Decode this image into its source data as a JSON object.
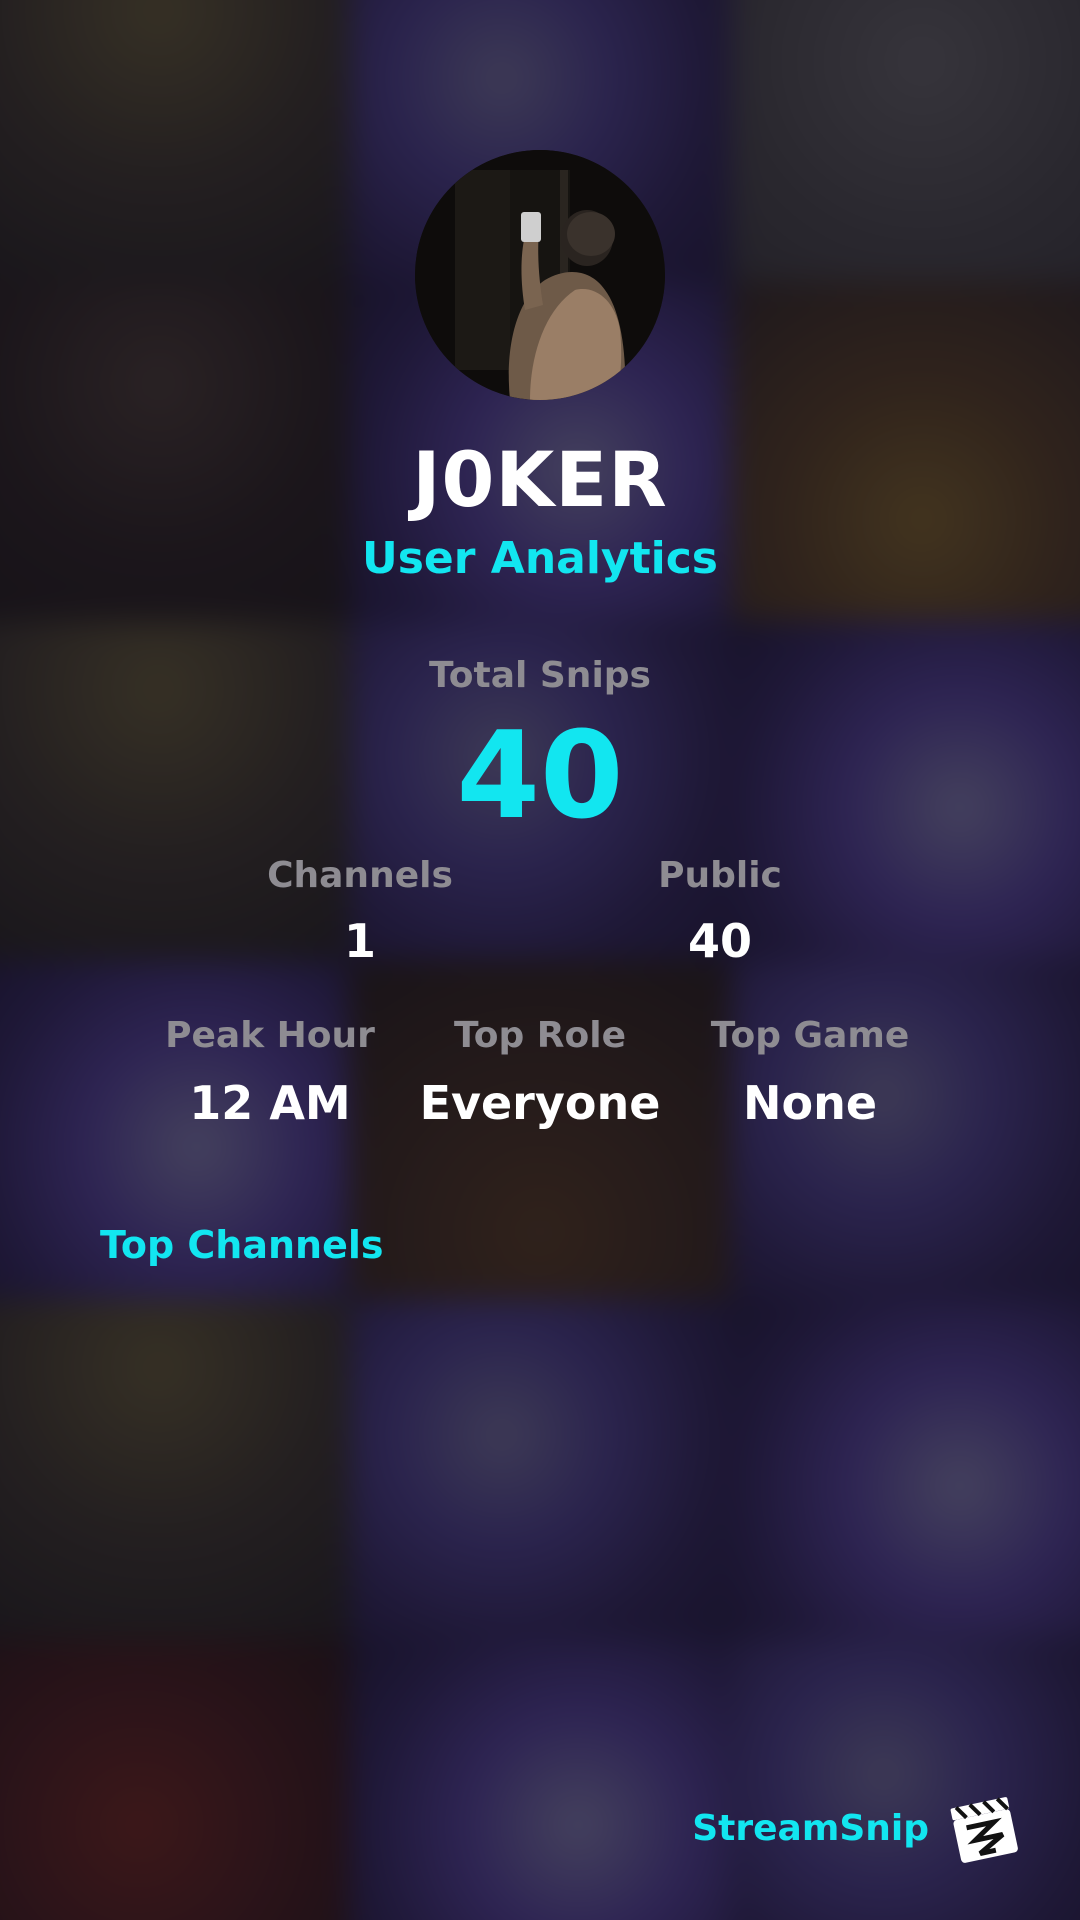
{
  "profile": {
    "username": "J0KER",
    "subtitle": "User Analytics"
  },
  "stats": {
    "total_snips_label": "Total Snips",
    "total_snips_value": "40",
    "channels_label": "Channels",
    "channels_value": "1",
    "public_label": "Public",
    "public_value": "40",
    "peak_hour_label": "Peak Hour",
    "peak_hour_value": "12 AM",
    "top_role_label": "Top Role",
    "top_role_value": "Everyone",
    "top_game_label": "Top Game",
    "top_game_value": "None"
  },
  "sections": {
    "top_channels_label": "Top Channels"
  },
  "brand": {
    "name": "StreamSnip",
    "logo_icon": "clapperboard-logo-icon"
  },
  "colors": {
    "accent": "#12e6f0",
    "label": "#8e8c92",
    "value": "#ffffff"
  }
}
